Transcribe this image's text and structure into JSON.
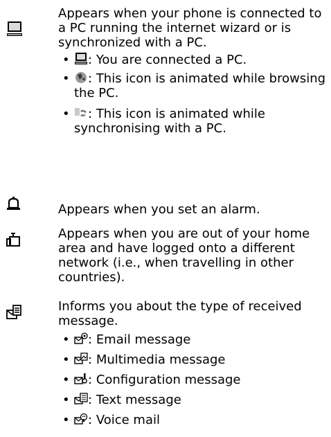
{
  "entries": [
    {
      "icon": "pc-connection-icon",
      "description": "Appears when your phone is connected to a PC running the internet wizard or is synchronized with a PC.",
      "items": [
        {
          "icon": "pc-connected-icon",
          "text": "You are connected a PC."
        },
        {
          "icon": "pc-browsing-icon",
          "text": "This icon is animated while browsing the PC."
        },
        {
          "icon": "pc-sync-icon",
          "text": "This icon is animated while synchronising with a PC."
        }
      ]
    },
    {
      "icon": "alarm-bell-icon",
      "description": "Appears when you set an alarm."
    },
    {
      "icon": "roaming-icon",
      "description": "Appears when you are out of your home area and have logged onto a different network (i.e., when travelling in other countries)."
    },
    {
      "icon": "message-type-icon",
      "description": "Informs you about the type of received message.",
      "items": [
        {
          "icon": "email-message-icon",
          "text": "Email message"
        },
        {
          "icon": "multimedia-message-icon",
          "text": "Multimedia message"
        },
        {
          "icon": "configuration-message-icon",
          "text": "Configuration message"
        },
        {
          "icon": "text-message-icon",
          "text": "Text message"
        },
        {
          "icon": "voice-mail-icon",
          "text": "Voice mail"
        }
      ]
    }
  ],
  "bullet": "•",
  "separator": ":"
}
